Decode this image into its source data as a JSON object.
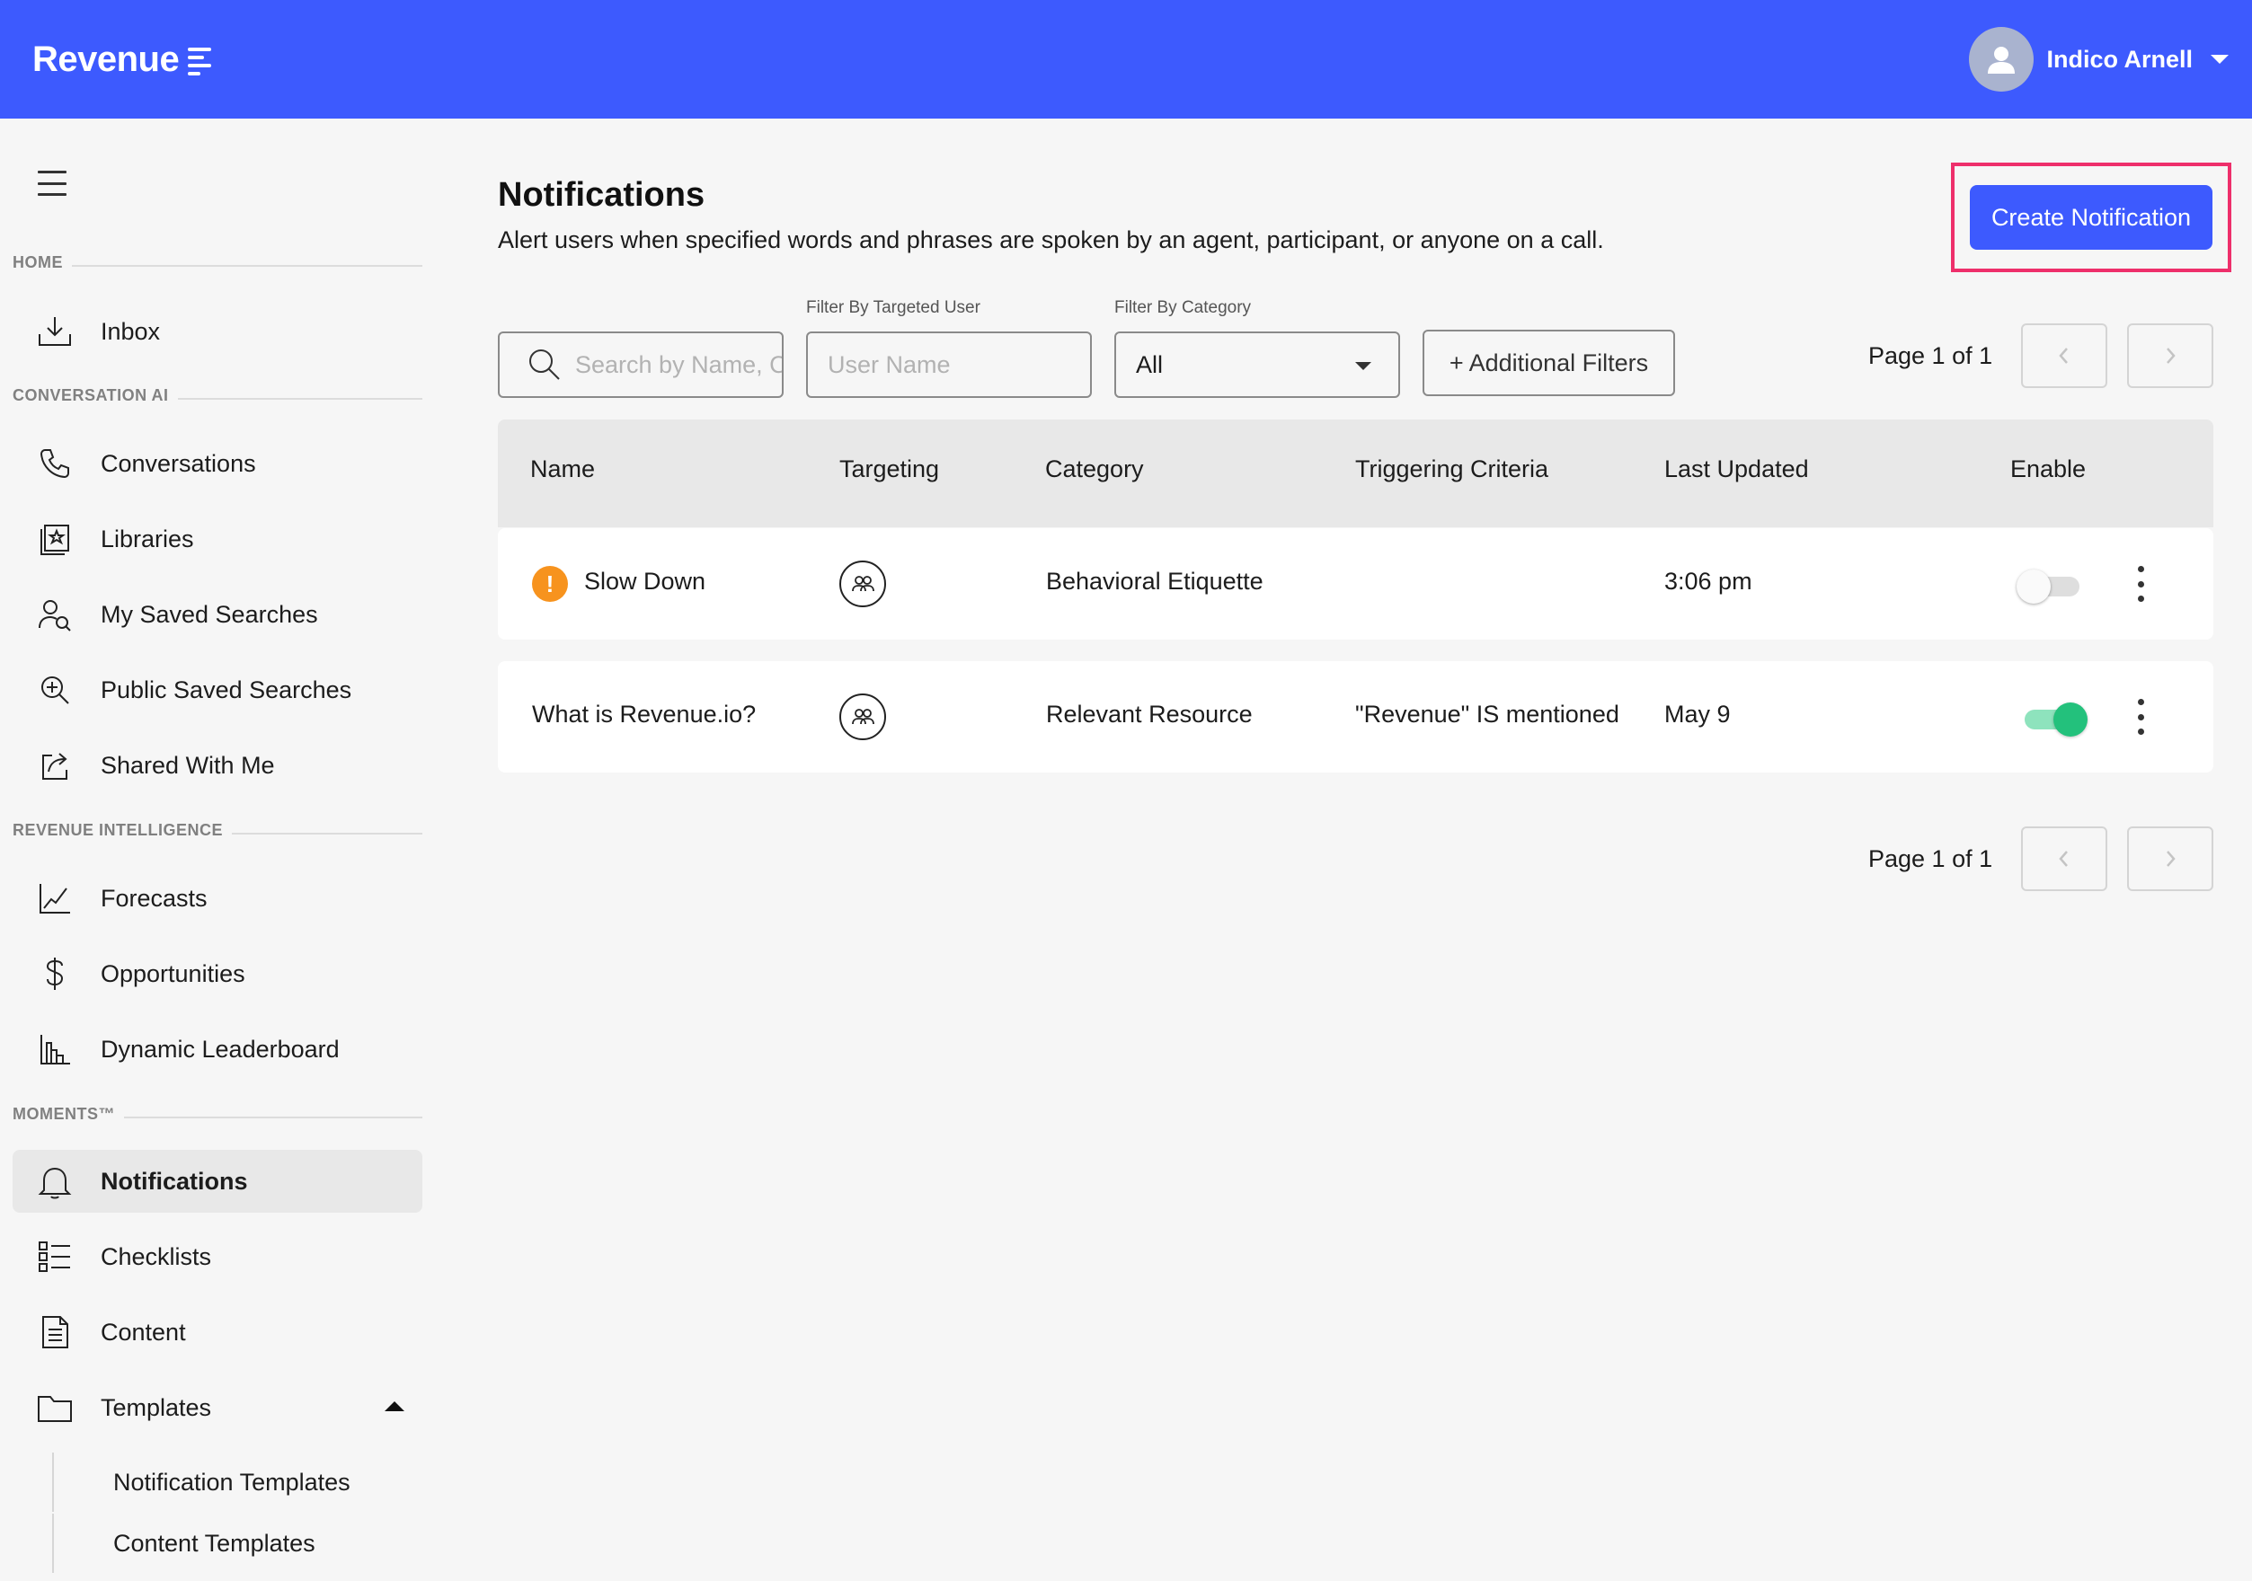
{
  "header": {
    "brand": "Revenue",
    "user_name": "Indico Arnell"
  },
  "sidebar": {
    "sections": {
      "home": "HOME",
      "conversation_ai": "CONVERSATION AI",
      "revenue_intelligence": "REVENUE INTELLIGENCE",
      "moments": "MOMENTS™"
    },
    "items": {
      "inbox": "Inbox",
      "conversations": "Conversations",
      "libraries": "Libraries",
      "my_saved_searches": "My Saved Searches",
      "public_saved_searches": "Public Saved Searches",
      "shared_with_me": "Shared With Me",
      "forecasts": "Forecasts",
      "opportunities": "Opportunities",
      "dynamic_leaderboard": "Dynamic Leaderboard",
      "notifications": "Notifications",
      "checklists": "Checklists",
      "content": "Content",
      "templates": "Templates",
      "notification_templates": "Notification Templates",
      "content_templates": "Content Templates"
    },
    "active": "notifications"
  },
  "page": {
    "title": "Notifications",
    "subtitle": "Alert users when specified words and phrases are spoken by an agent, participant, or anyone on a call.",
    "create_button": "Create Notification"
  },
  "filters": {
    "search_placeholder": "Search by Name, Category",
    "user_label": "Filter By Targeted User",
    "user_placeholder": "User Name",
    "category_label": "Filter By Category",
    "category_value": "All",
    "additional_filters": "+ Additional Filters"
  },
  "pagination": {
    "top_text": "Page 1 of 1",
    "bottom_text": "Page 1 of 1"
  },
  "table": {
    "headers": {
      "name": "Name",
      "targeting": "Targeting",
      "category": "Category",
      "criteria": "Triggering Criteria",
      "updated": "Last Updated",
      "enable": "Enable"
    },
    "rows": [
      {
        "name": "Slow Down",
        "warning": "!",
        "category": "Behavioral Etiquette",
        "criteria": "",
        "updated": "3:06 pm",
        "enabled": false
      },
      {
        "name": "What is Revenue.io?",
        "category": "Relevant Resource",
        "criteria": "\"Revenue\" IS mentioned",
        "updated": "May 9",
        "enabled": true
      }
    ]
  },
  "colors": {
    "brand_blue": "#3d5afe",
    "highlight_pink": "#ee2f6b",
    "warning_orange": "#f7931e",
    "toggle_green": "#23c17c"
  }
}
